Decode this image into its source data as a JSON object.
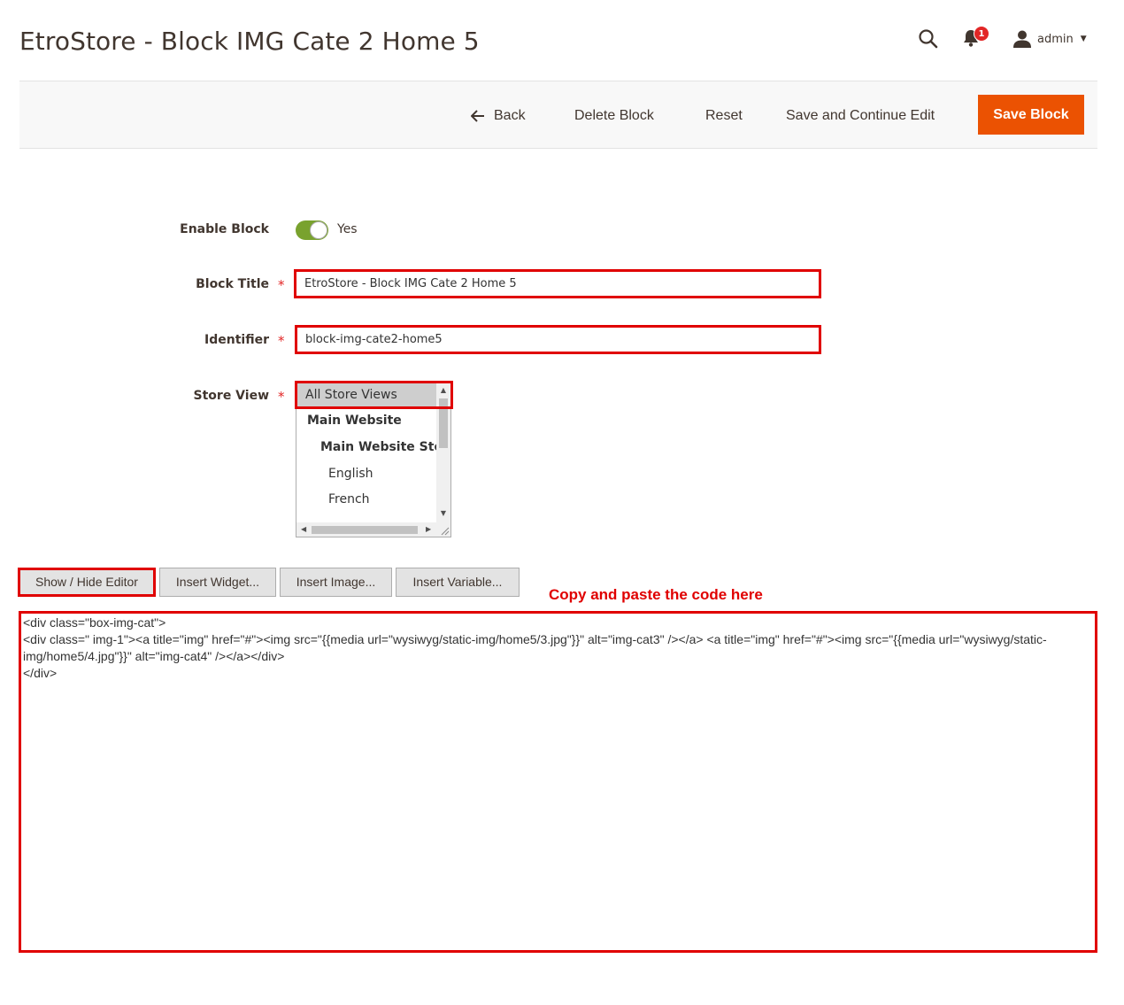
{
  "page": {
    "title": "EtroStore - Block IMG Cate 2 Home 5"
  },
  "header": {
    "notifications_count": "1",
    "user_name": "admin"
  },
  "toolbar": {
    "back_label": "Back",
    "delete_label": "Delete Block",
    "reset_label": "Reset",
    "save_continue_label": "Save and Continue Edit",
    "save_label": "Save Block"
  },
  "form": {
    "enable_block": {
      "label": "Enable Block",
      "value_text": "Yes",
      "enabled": true
    },
    "block_title": {
      "label": "Block Title",
      "value": "EtroStore - Block IMG Cate 2 Home 5"
    },
    "identifier": {
      "label": "Identifier",
      "value": "block-img-cate2-home5"
    },
    "store_view": {
      "label": "Store View",
      "options": [
        {
          "label": "All Store Views",
          "selected": true
        },
        {
          "label": "Main Website",
          "bold": true
        },
        {
          "label": "Main Website Store",
          "bold": true
        },
        {
          "label": "English"
        },
        {
          "label": "French"
        }
      ]
    }
  },
  "editor": {
    "show_hide_label": "Show / Hide Editor",
    "insert_widget_label": "Insert Widget...",
    "insert_image_label": "Insert Image...",
    "insert_variable_label": "Insert Variable...",
    "annotation": "Copy and paste the code here",
    "content": "<div class=\"box-img-cat\">\n<div class=\" img-1\"><a title=\"img\" href=\"#\"><img src=\"{{media url=\"wysiwyg/static-img/home5/3.jpg\"}}\" alt=\"img-cat3\" /></a> <a title=\"img\" href=\"#\"><img src=\"{{media url=\"wysiwyg/static-img/home5/4.jpg\"}}\" alt=\"img-cat4\" /></a></div>\n</div>"
  },
  "colors": {
    "accent": "#eb5202",
    "highlight": "#e00000",
    "toggle_on": "#79a22e"
  }
}
